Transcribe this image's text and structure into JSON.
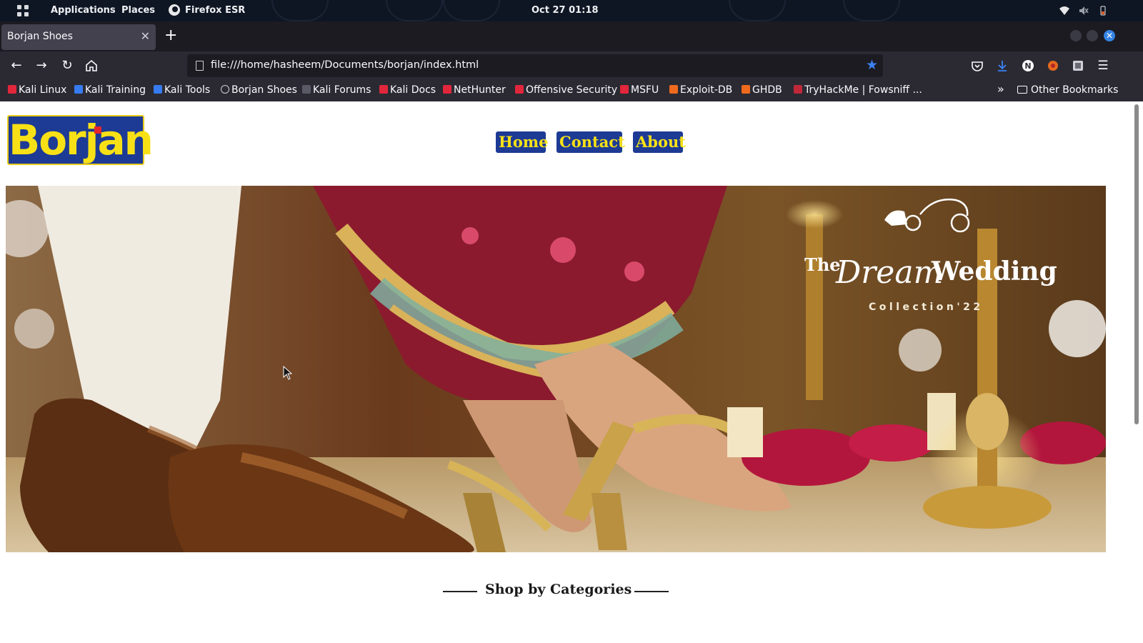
{
  "panel": {
    "applications": "Applications",
    "places": "Places",
    "app_name": "Firefox ESR",
    "clock": "Oct 27  01:18"
  },
  "browser": {
    "tab_title": "Borjan Shoes",
    "url": "file:///home/hasheem/Documents/borjan/index.html",
    "bookmarked": true
  },
  "bookmarks": [
    {
      "label": "Kali Linux",
      "color": "#e2263b"
    },
    {
      "label": "Kali Training",
      "color": "#367bf0"
    },
    {
      "label": "Kali Tools",
      "color": "#367bf0"
    },
    {
      "label": "Borjan Shoes",
      "color": "#cfcfd8"
    },
    {
      "label": "Kali Forums",
      "color": "#cfcfd8"
    },
    {
      "label": "Kali Docs",
      "color": "#e2263b"
    },
    {
      "label": "NetHunter",
      "color": "#e2263b"
    },
    {
      "label": "Offensive Security",
      "color": "#e2263b"
    },
    {
      "label": "MSFU",
      "color": "#e2263b"
    },
    {
      "label": "Exploit-DB",
      "color": "#f06a1d"
    },
    {
      "label": "GHDB",
      "color": "#f06a1d"
    },
    {
      "label": "TryHackMe | Fowsniff ...",
      "color": "#c0283a"
    }
  ],
  "other_bookmarks": "Other Bookmarks",
  "site": {
    "logo": "Borjan",
    "nav": [
      "Home",
      "Contact",
      "About"
    ],
    "hero": {
      "the": "The",
      "dream": "Dream",
      "wedding": "Wedding",
      "subtitle": "Collection'22"
    },
    "section_heading": "Shop by Categories"
  },
  "colors": {
    "brand_blue": "#1d3a94",
    "brand_yellow": "#f7e116",
    "accent_star": "#3b82f6"
  }
}
